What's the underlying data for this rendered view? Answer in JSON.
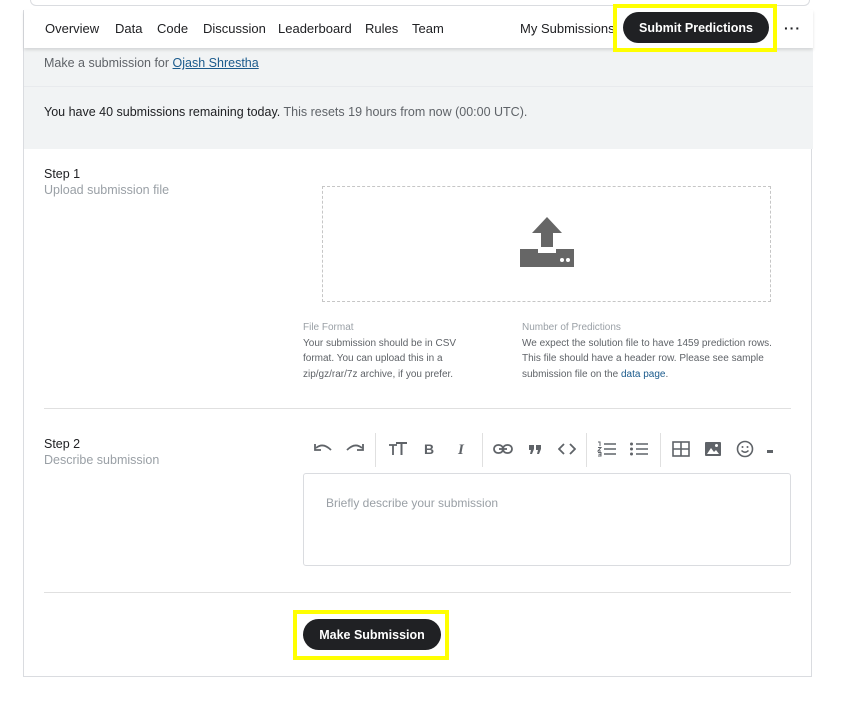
{
  "nav": {
    "tabs": [
      "Overview",
      "Data",
      "Code",
      "Discussion",
      "Leaderboard",
      "Rules",
      "Team"
    ],
    "my_submissions": "My Submissions",
    "submit_predictions": "Submit Predictions",
    "more": "···"
  },
  "header": {
    "make_submission_prefix": "Make a submission for",
    "user_name": "Ojash Shrestha",
    "remaining_bold": "You have 40 submissions remaining today.",
    "remaining_rest": " This resets 19 hours from now (00:00 UTC)."
  },
  "step1": {
    "title": "Step 1",
    "subtitle": "Upload submission file",
    "upload_icon": "upload-icon",
    "file_format_label": "File Format",
    "file_format_text_1": "Your submission should be in CSV",
    "file_format_text_2": "format. You can upload this in a",
    "file_format_text_3": "zip/gz/rar/7z archive, if you prefer.",
    "predictions_label": "Number of Predictions",
    "predictions_text_1": "We expect the solution file to have 1459 prediction rows.",
    "predictions_text_2": "This file should have a header row. Please see sample",
    "predictions_text_3": "submission file on the ",
    "data_page_link": "data page",
    "predictions_text_4": "."
  },
  "step2": {
    "title": "Step 2",
    "subtitle": "Describe submission",
    "placeholder": "Briefly describe your submission",
    "toolbar_icons": [
      "undo-icon",
      "redo-icon",
      "text-size-icon",
      "bold-icon",
      "italic-icon",
      "link-icon",
      "quote-icon",
      "code-icon",
      "numbered-list-icon",
      "bullet-list-icon",
      "table-icon",
      "image-icon",
      "emoji-icon",
      "more-icon"
    ]
  },
  "footer": {
    "make_submission": "Make Submission"
  },
  "colors": {
    "highlight": "#ffff00",
    "button_dark": "#202124",
    "link": "#1a5a8c",
    "band": "#f1f3f4"
  }
}
